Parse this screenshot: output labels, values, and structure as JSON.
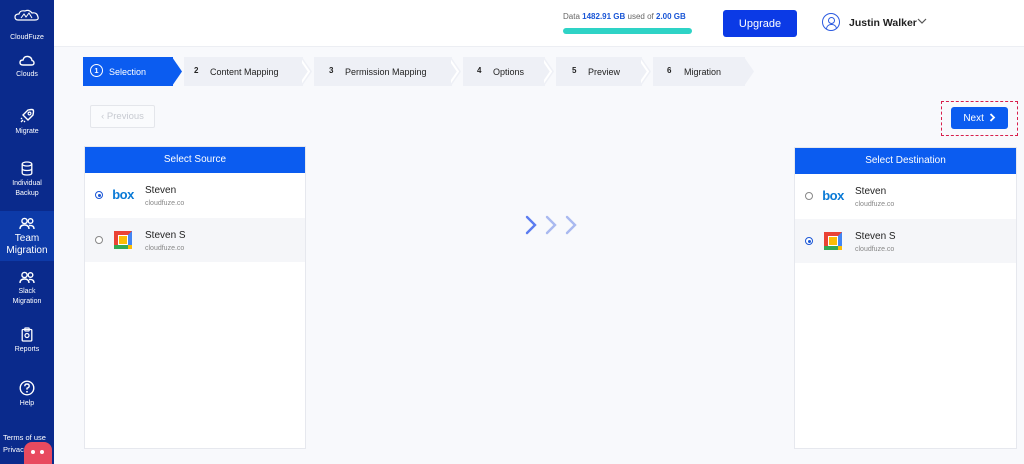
{
  "app": {
    "brand": "CloudFuze"
  },
  "sidebar": {
    "items": [
      {
        "label": "Clouds",
        "icon": "cloud-icon"
      },
      {
        "label": "Migrate",
        "icon": "rocket-icon"
      },
      {
        "label": "Individual Backup",
        "line1": "Individual",
        "line2": "Backup",
        "icon": "database-icon"
      },
      {
        "label": "Team Migration",
        "line1": "Team",
        "line2": "Migration",
        "icon": "team-icon",
        "active": true
      },
      {
        "label": "Slack Migration",
        "line1": "Slack",
        "line2": "Migration",
        "icon": "slack-team-icon"
      },
      {
        "label": "Reports",
        "icon": "clipboard-icon"
      },
      {
        "label": "Help",
        "icon": "help-icon"
      }
    ],
    "terms": "Terms of use",
    "privacy": "Privac"
  },
  "header": {
    "usage_prefix": "Data",
    "usage_used": "1482.91 GB",
    "usage_mid": "used of",
    "usage_total": "2.00 GB",
    "usage_fill": 1.0,
    "upgrade_label": "Upgrade",
    "user_name": "Justin Walker"
  },
  "stepper": {
    "steps": [
      {
        "num": "1",
        "label": "Selection",
        "active": true
      },
      {
        "num": "2",
        "label": "Content Mapping"
      },
      {
        "num": "3",
        "label": "Permission Mapping"
      },
      {
        "num": "4",
        "label": "Options"
      },
      {
        "num": "5",
        "label": "Preview"
      },
      {
        "num": "6",
        "label": "Migration"
      }
    ]
  },
  "nav": {
    "previous_label": "Previous",
    "next_label": "Next"
  },
  "source": {
    "title": "Select Source",
    "accounts": [
      {
        "name": "Steven",
        "domain": "cloudfuze.co",
        "cloud": "box",
        "selected": true
      },
      {
        "name": "Steven S",
        "domain": "cloudfuze.co",
        "cloud": "google-workspace",
        "selected": false
      }
    ]
  },
  "destination": {
    "title": "Select Destination",
    "accounts": [
      {
        "name": "Steven",
        "domain": "cloudfuze.co",
        "cloud": "box",
        "selected": false
      },
      {
        "name": "Steven S",
        "domain": "cloudfuze.co",
        "cloud": "google-workspace",
        "selected": true
      }
    ]
  },
  "colors": {
    "sidebar": "#0a2a8c",
    "primary": "#0b5cf0",
    "usage_bar": "#2ed3c6",
    "highlight": "#d81f4c"
  },
  "box_logo_text": "box"
}
